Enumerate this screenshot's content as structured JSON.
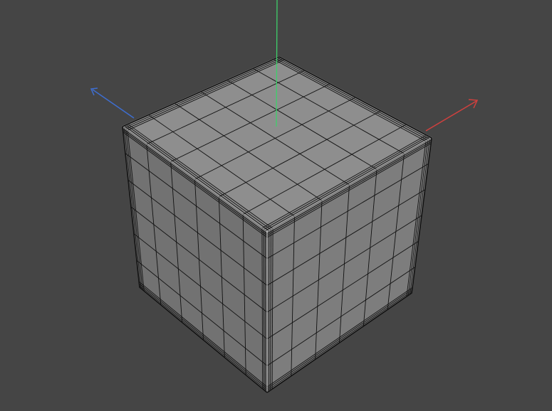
{
  "viewport": {
    "background": "#454545",
    "object": "cube",
    "subdivision": {
      "main_segments": 6,
      "bevel_segments": 3
    },
    "shading": {
      "top_face": "#8e8e8e",
      "left_face": "#727272",
      "right_face": "#7d7d7d",
      "edge_highlight": "#bdbdbd",
      "wireframe": "#111111"
    },
    "axes": {
      "x": {
        "color": "#d0403e",
        "icon": "x-axis-arrow-icon"
      },
      "y": {
        "color": "#3ed06a",
        "icon": "y-axis-line-icon"
      },
      "z": {
        "color": "#3e6ed0",
        "icon": "z-axis-arrow-icon"
      }
    }
  }
}
